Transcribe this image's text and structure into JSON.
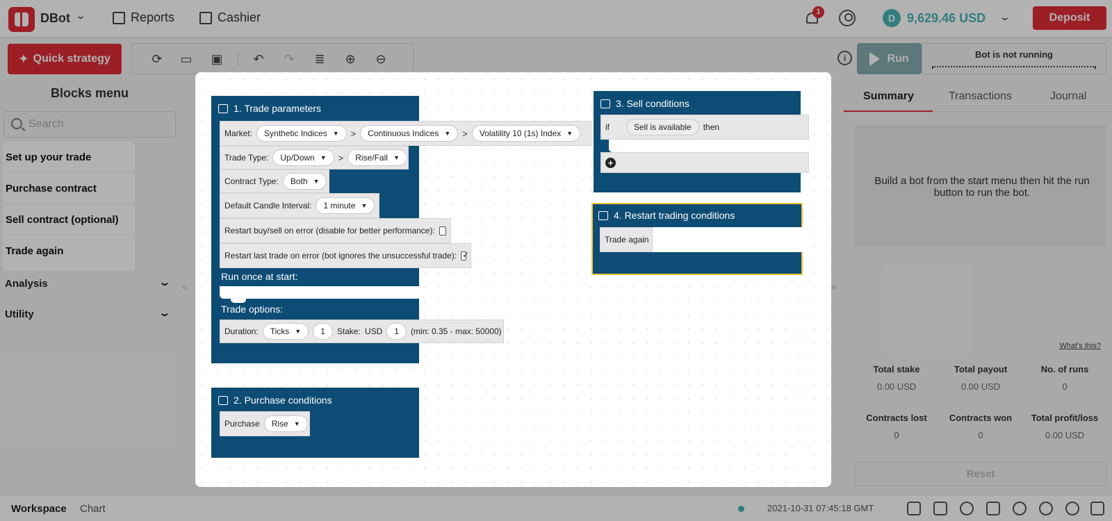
{
  "header": {
    "app_name": "DBot",
    "nav": [
      {
        "label": "Reports",
        "icon": "reports-icon"
      },
      {
        "label": "Cashier",
        "icon": "cashier-icon"
      }
    ],
    "notification_count": "1",
    "balance": "9,629.46 USD",
    "deposit_label": "Deposit"
  },
  "toolbar": {
    "quick_strategy_label": "Quick strategy",
    "icons": [
      "reset-icon",
      "import-icon",
      "save-icon",
      "undo-icon",
      "redo-icon",
      "sort-icon",
      "zoom-in-icon",
      "zoom-out-icon"
    ]
  },
  "run": {
    "run_label": "Run",
    "status": "Bot is not running"
  },
  "blocks_menu": {
    "title": "Blocks menu",
    "search_placeholder": "Search",
    "quick_items": [
      "Set up your trade",
      "Purchase contract",
      "Sell contract (optional)",
      "Trade again"
    ],
    "sections": [
      "Analysis",
      "Utility"
    ]
  },
  "right_panel": {
    "tabs": [
      "Summary",
      "Transactions",
      "Journal"
    ],
    "message": "Build a bot from the start menu then hit the run button to run the bot.",
    "whats_this": "What's this?",
    "stats": [
      {
        "label": "Total stake",
        "value": "0.00 USD"
      },
      {
        "label": "Total payout",
        "value": "0.00 USD"
      },
      {
        "label": "No. of runs",
        "value": "0"
      },
      {
        "label": "Contracts lost",
        "value": "0"
      },
      {
        "label": "Contracts won",
        "value": "0"
      },
      {
        "label": "Total profit/loss",
        "value": "0.00 USD"
      }
    ],
    "reset_label": "Reset"
  },
  "workspace": {
    "trade_params": {
      "title": "1. Trade parameters",
      "market_label": "Market:",
      "market": [
        "Synthetic Indices",
        "Continuous Indices",
        "Volatility 10 (1s) Index"
      ],
      "trade_type_label": "Trade Type:",
      "trade_type": [
        "Up/Down",
        "Rise/Fall"
      ],
      "contract_type_label": "Contract Type:",
      "contract_type": "Both",
      "candle_label": "Default Candle Interval:",
      "candle": "1 minute",
      "restart_error_label": "Restart buy/sell on error (disable for better performance):",
      "restart_last_label": "Restart last trade on error (bot ignores the unsuccessful trade):",
      "run_once_label": "Run once at start:",
      "trade_options_label": "Trade options:",
      "duration_label": "Duration:",
      "duration_unit": "Ticks",
      "duration_value": "1",
      "stake_label": "Stake:",
      "currency": "USD",
      "stake_value": "1",
      "stake_limits": "(min: 0.35 - max: 50000)"
    },
    "purchase": {
      "title": "2. Purchase conditions",
      "label": "Purchase",
      "value": "Rise"
    },
    "sell": {
      "title": "3. Sell conditions",
      "if_label": "if",
      "condition": "Sell is available",
      "then_label": "then"
    },
    "restart": {
      "title": "4. Restart trading conditions",
      "action": "Trade again"
    }
  },
  "footer": {
    "tabs": [
      "Workspace",
      "Chart"
    ],
    "timestamp": "2021-10-31 07:45:18 GMT",
    "icons": [
      "statement-icon",
      "chat-icon",
      "theme-icon",
      "security-icon",
      "responsible-trading-icon",
      "help-icon",
      "settings-icon",
      "fullscreen-icon"
    ]
  }
}
